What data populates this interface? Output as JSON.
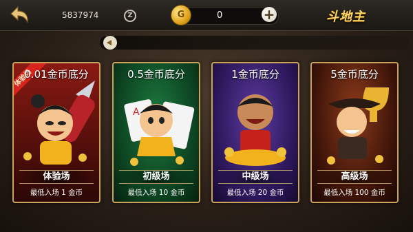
{
  "header": {
    "user_id": "5837974",
    "coin_amount": "0",
    "game_title": "斗地主"
  },
  "rooms": [
    {
      "score": "0.01金币底分",
      "name": "体验场",
      "min_entry": "最低入场  1  金币",
      "badge": "体验场",
      "accent": "#c7251a"
    },
    {
      "score": "0.5金币底分",
      "name": "初级场",
      "min_entry": "最低入场  10  金币",
      "accent": "#0f6a33"
    },
    {
      "score": "1金币底分",
      "name": "中级场",
      "min_entry": "最低入场  20  金币",
      "accent": "#4a2a7e"
    },
    {
      "score": "5金币底分",
      "name": "高级场",
      "min_entry": "最低入场  100  金币",
      "accent": "#5e1a14"
    }
  ]
}
